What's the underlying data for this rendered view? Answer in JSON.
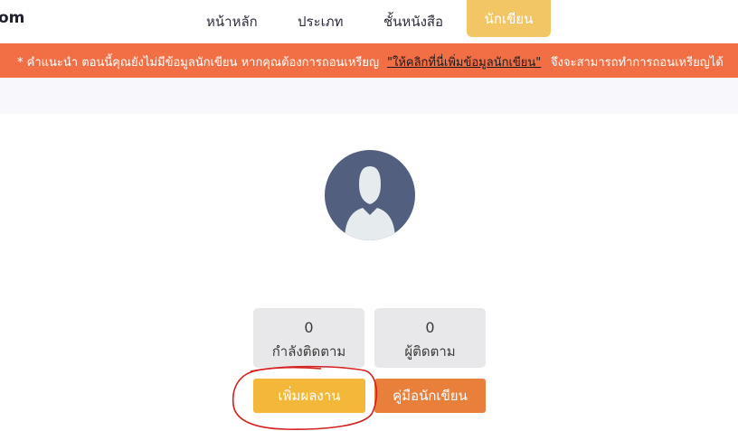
{
  "header": {
    "logo_fragment": "om",
    "nav": [
      {
        "label": "หน้าหลัก"
      },
      {
        "label": "ประเภท"
      },
      {
        "label": "ชั้นหนังสือ"
      },
      {
        "label": "นักเขียน"
      }
    ]
  },
  "notice": {
    "prefix": "* คำแนะนำ ตอนนี้คุณยังไม่มีข้อมูลนักเขียน หากคุณต้องการถอนเหรียญ",
    "link": "\"ให้คลิกที่นี่เพิ่มข้อมูลนักเขียน\"",
    "suffix": "จึงจะสามารถทำการถอนเหรียญได้"
  },
  "profile": {
    "avatar_icon": "user-avatar-icon",
    "stats": [
      {
        "value": "0",
        "label": "กำลังติดตาม"
      },
      {
        "value": "0",
        "label": "ผู้ติดตาม"
      }
    ],
    "buttons": {
      "add_work": "เพิ่มผลงาน",
      "writer_guide": "คู่มือนักเขียน"
    }
  },
  "colors": {
    "accent_yellow": "#f3c665",
    "notice_orange": "#f26f45",
    "add_button": "#f3b83a",
    "guide_button": "#e87f3a",
    "annotation_red": "#d61f1f"
  }
}
